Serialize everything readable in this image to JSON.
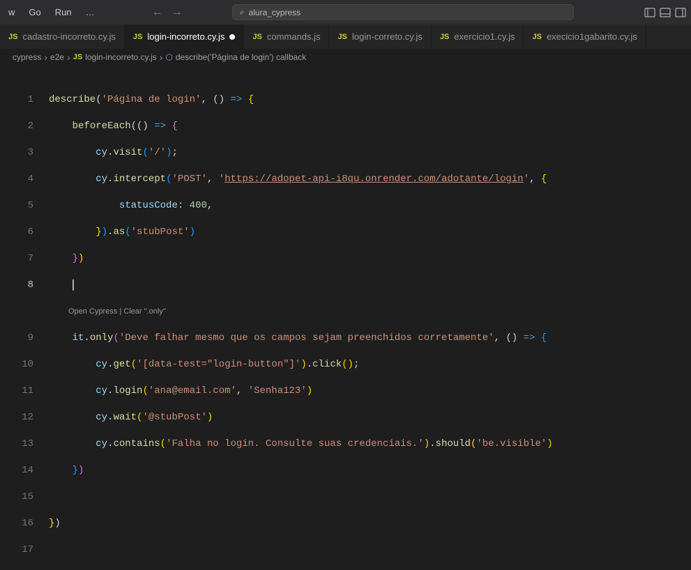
{
  "menu": {
    "view": "w",
    "go": "Go",
    "run": "Run",
    "more": "…"
  },
  "search": {
    "icon": "⌕",
    "value": "alura_cypress"
  },
  "tabs": [
    {
      "icon": "JS",
      "name": "cadastro-incorreto.cy.js"
    },
    {
      "icon": "JS",
      "name": "login-incorreto.cy.js",
      "active": true,
      "dirty": true
    },
    {
      "icon": "JS",
      "name": "commands.js"
    },
    {
      "icon": "JS",
      "name": "login-correto.cy.js"
    },
    {
      "icon": "JS",
      "name": "exercicio1.cy.js"
    },
    {
      "icon": "JS",
      "name": "execicio1gabarito.cy.js"
    }
  ],
  "breadcrumb": {
    "parts": [
      "cypress",
      "e2e",
      "login-incorreto.cy.js",
      "describe('Página de login') callback"
    ]
  },
  "codelens": "Open Cypress | Clear \".only\"",
  "code": {
    "l1_fn": "describe",
    "l1_str": "'Página de login'",
    "l2_fn": "beforeEach",
    "l3_obj": "cy",
    "l3_fn": "visit",
    "l3_str": "'/'",
    "l4_obj": "cy",
    "l4_fn": "intercept",
    "l4_str1": "'POST'",
    "l4_url": "https://adopet-api-i8qu.onrender.com/adotante/login",
    "l5_prop": "statusCode",
    "l5_num": "400",
    "l6_fn": "as",
    "l6_str": "'stubPost'",
    "l9_obj": "it",
    "l9_prop": "only",
    "l9_str": "'Deve falhar mesmo que os campos sejam preenchidos corretamente'",
    "l10_obj": "cy",
    "l10_fn1": "get",
    "l10_str": "'[data-test=\"login-button\"]'",
    "l10_fn2": "click",
    "l11_obj": "cy",
    "l11_fn": "login",
    "l11_str1": "'ana@email.com'",
    "l11_str2": "'Senha123'",
    "l12_obj": "cy",
    "l12_fn": "wait",
    "l12_str": "'@stubPost'",
    "l13_obj": "cy",
    "l13_fn1": "contains",
    "l13_str1": "'Falha no login. Consulte suas credenciais.'",
    "l13_fn2": "should",
    "l13_str2": "'be.visible'"
  }
}
